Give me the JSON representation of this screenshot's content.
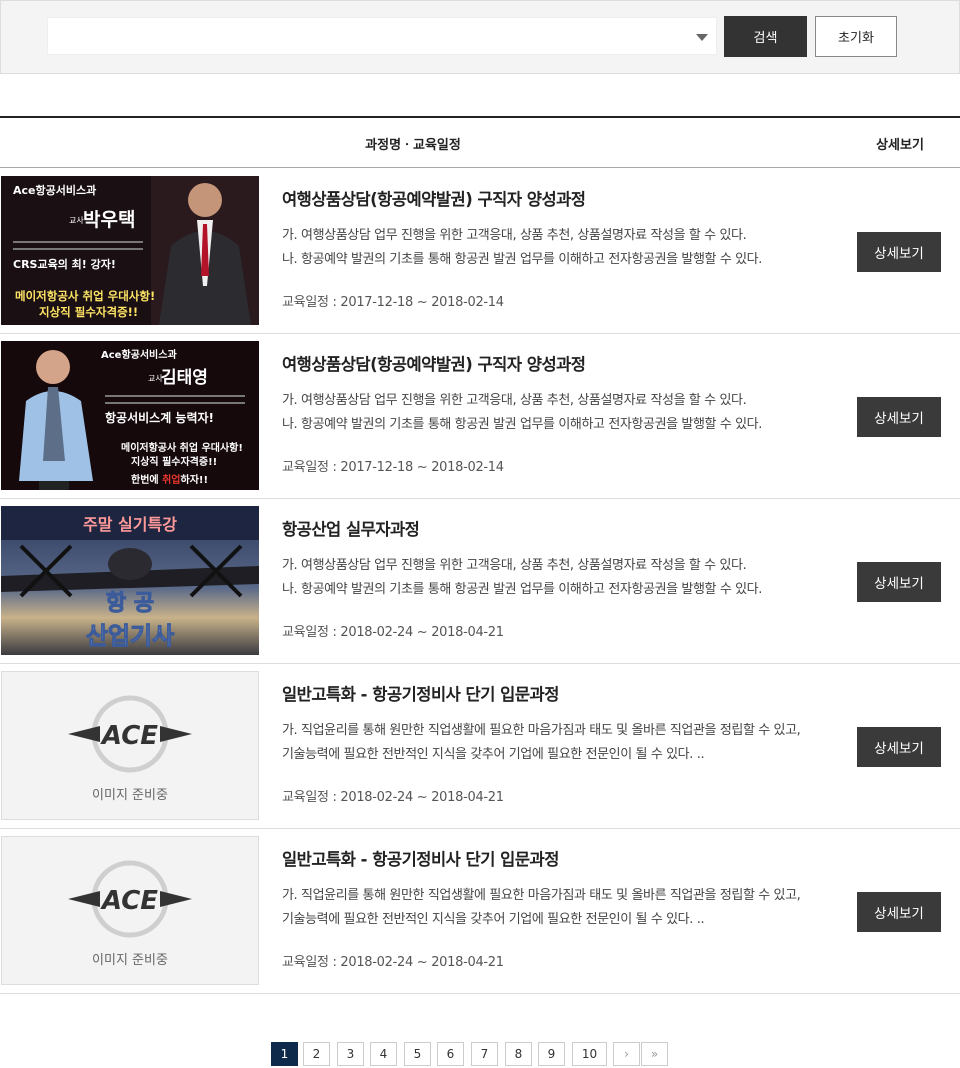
{
  "search": {
    "selected": "",
    "search_label": "검색",
    "reset_label": "초기화"
  },
  "table": {
    "header_course": "과정명ㆍ교육일정",
    "header_detail": "상세보기"
  },
  "courses": [
    {
      "title": "여행상품상담(항공예약발권) 구직자 양성과정",
      "desc1": "가. 여행상품상담 업무 진행을 위한 고객응대, 상품 추천, 상품설명자료 작성을 할 수 있다.",
      "desc2": "나. 항공예약 발권의 기초를 통해 항공권 발권 업무를 이해하고 전자항공권을 발행할 수 있다.",
      "date": "교육일정 : 2017-12-18 ~ 2018-02-14",
      "button": "상세보기",
      "thumb": {
        "top": "Ace항공서비스과",
        "teacher_title": "교사",
        "name": "박우택",
        "line1": "CRS교육의 최! 강자!",
        "line2": "메이저항공사 취업 우대사항!",
        "line3": "지상직 필수자격증!!"
      }
    },
    {
      "title": "여행상품상담(항공예약발권) 구직자 양성과정",
      "desc1": "가. 여행상품상담 업무 진행을 위한 고객응대, 상품 추천, 상품설명자료 작성을 할 수 있다.",
      "desc2": "나. 항공예약 발권의 기초를 통해 항공권 발권 업무를 이해하고 전자항공권을 발행할 수 있다.",
      "date": "교육일정 : 2017-12-18 ~ 2018-02-14",
      "button": "상세보기",
      "thumb": {
        "top": "Ace항공서비스과",
        "teacher_title": "교사",
        "name": "김태영",
        "line1": "항공서비스계 능력자!",
        "line2": "메이저항공사 취업 우대사항!",
        "line3": "지상직 필수자격증!!",
        "line4a": "한번에 ",
        "line4b": "취업",
        "line4c": "하자!!"
      }
    },
    {
      "title": "항공산업 실무자과정",
      "desc1": "가. 여행상품상담 업무 진행을 위한 고객응대, 상품 추천, 상품설명자료 작성을 할 수 있다.",
      "desc2": "나. 항공예약 발권의 기초를 통해 항공권 발권 업무를 이해하고 전자항공권을 발행할 수 있다.",
      "date": "교육일정 : 2018-02-24 ~ 2018-04-21",
      "button": "상세보기",
      "thumb": {
        "top": "주말 실기특강",
        "line1": "항 공",
        "line2": "산업기사"
      }
    },
    {
      "title": "일반고특화 - 항공기정비사 단기 입문과정",
      "desc1": "가. 직업윤리를 통해 원만한 직업생활에 필요한 마음가짐과 태도 및 올바른 직업관을 정립할 수 있고,",
      "desc2": "기술능력에 필요한 전반적인 지식을 갖추어 기업에 필요한 전문인이 될 수 있다. ..",
      "date": "교육일정 : 2018-02-24 ~ 2018-04-21",
      "button": "상세보기",
      "thumb": {
        "logo": "ACE",
        "caption": "이미지 준비중"
      }
    },
    {
      "title": "일반고특화 - 항공기정비사 단기 입문과정",
      "desc1": "가. 직업윤리를 통해 원만한 직업생활에 필요한 마음가짐과 태도 및 올바른 직업관을 정립할 수 있고,",
      "desc2": "기술능력에 필요한 전반적인 지식을 갖추어 기업에 필요한 전문인이 될 수 있다. ..",
      "date": "교육일정 : 2018-02-24 ~ 2018-04-21",
      "button": "상세보기",
      "thumb": {
        "logo": "ACE",
        "caption": "이미지 준비중"
      }
    }
  ],
  "pagination": {
    "pages": [
      "1",
      "2",
      "3",
      "4",
      "5",
      "6",
      "7",
      "8",
      "9",
      "10"
    ],
    "current": "1",
    "next": "›",
    "last": "»"
  }
}
